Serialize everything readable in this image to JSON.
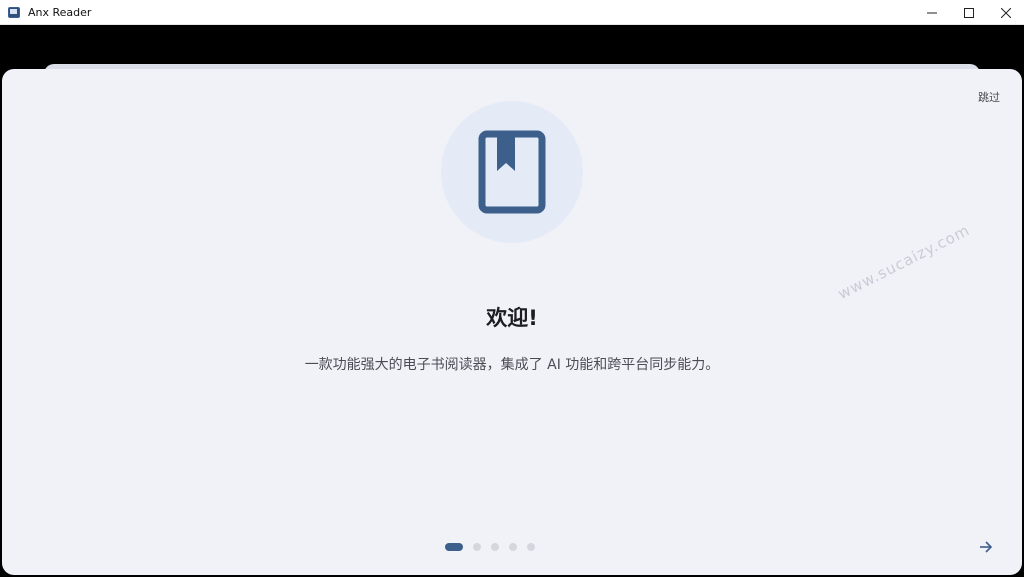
{
  "window": {
    "title": "Anx Reader",
    "controls": {
      "minimize": "—",
      "maximize": "☐",
      "close": "✕"
    }
  },
  "onboarding": {
    "skip_label": "跳过",
    "hero_icon": "book-bookmark-icon",
    "headline": "欢迎!",
    "description": "一款功能强大的电子书阅读器，集成了 AI 功能和跨平台同步能力。",
    "page_index": 1,
    "page_count": 5,
    "next_icon": "arrow-right-icon"
  },
  "watermark": "www.sucaizy.com",
  "colors": {
    "accent": "#3c5f8b",
    "sheet_bg": "#f1f2f8",
    "icon_circle": "#e4ebf6"
  }
}
